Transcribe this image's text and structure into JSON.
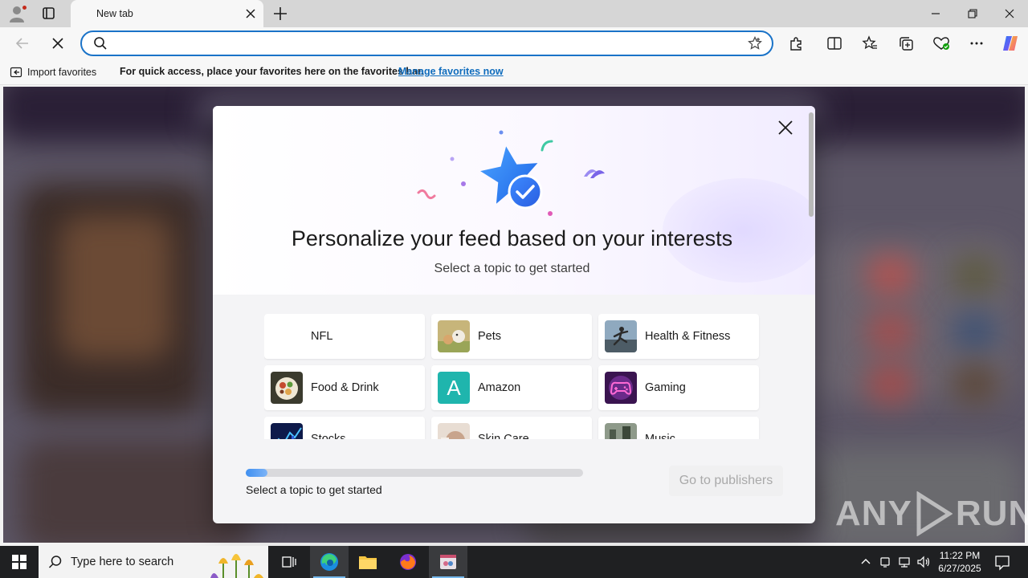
{
  "browser": {
    "tab": {
      "title": "New tab"
    },
    "address_bar": {
      "value": "",
      "placeholder": ""
    },
    "favorites_bar": {
      "import_label": "Import favorites",
      "hint": "For quick access, place your favorites here on the favorites bar.",
      "manage_link": "Manage favorites now"
    }
  },
  "modal": {
    "title": "Personalize your feed based on your interests",
    "subtitle": "Select a topic to get started",
    "topics": [
      {
        "label": "NFL",
        "icon": "none"
      },
      {
        "label": "Pets",
        "icon": "pets-image"
      },
      {
        "label": "Health & Fitness",
        "icon": "fitness-image"
      },
      {
        "label": "Food & Drink",
        "icon": "food-image"
      },
      {
        "label": "Amazon",
        "icon": "amazon-letter-icon",
        "letter": "A"
      },
      {
        "label": "Gaming",
        "icon": "gamepad-icon"
      },
      {
        "label": "Stocks",
        "icon": "stocks-image"
      },
      {
        "label": "Skin Care",
        "icon": "skincare-image"
      },
      {
        "label": "Music",
        "icon": "music-image"
      }
    ],
    "progress": {
      "fraction": 0.065,
      "text": "Select a topic to get started"
    },
    "go_button": "Go to publishers"
  },
  "watermark": {
    "text_left": "ANY",
    "text_right": "RUN"
  },
  "taskbar": {
    "search_placeholder": "Type here to search",
    "time": "11:22 PM",
    "date": "6/27/2025"
  },
  "colors": {
    "accent": "#1a73c8",
    "progress": "#3f8ff0",
    "star": "#3b82f6",
    "link": "#0f6cbd"
  }
}
